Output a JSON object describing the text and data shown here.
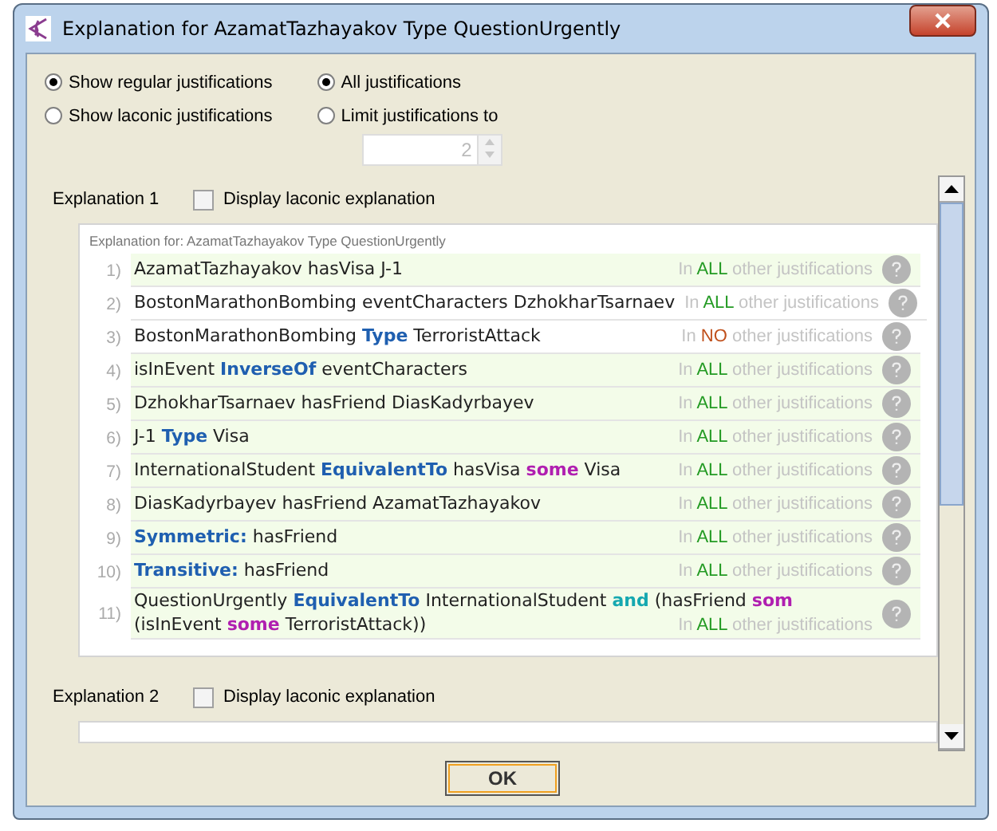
{
  "window": {
    "title": "Explanation for AzamatTazhayakov Type QuestionUrgently"
  },
  "justification_mode": [
    {
      "label": "Show regular justifications",
      "selected": true
    },
    {
      "label": "Show laconic justifications",
      "selected": false
    }
  ],
  "count_mode": [
    {
      "label": "All justifications",
      "selected": true
    },
    {
      "label": "Limit justifications to",
      "selected": false
    }
  ],
  "limit_spinner": {
    "value": "2",
    "disabled": true
  },
  "explanations": [
    {
      "title": "Explanation 1",
      "laconic_checkbox": {
        "label": "Display laconic explanation",
        "checked": false
      },
      "header": "Explanation for: AzamatTazhayakov Type QuestionUrgently",
      "axioms": [
        {
          "number": "1)",
          "highlighted": true,
          "lines": [
            [
              {
                "kind": "plain",
                "text": "AzamatTazhayakov hasVisa J-1"
              }
            ]
          ],
          "justification": {
            "prefix": "In",
            "scope": "ALL",
            "color": "#239a23",
            "suffix": "other justifications"
          }
        },
        {
          "number": "2)",
          "highlighted": false,
          "lines": [
            [
              {
                "kind": "plain",
                "text": "BostonMarathonBombing eventCharacters DzhokharTsarnaev"
              }
            ]
          ],
          "justification": {
            "prefix": "In",
            "scope": "ALL",
            "color": "#239a23",
            "suffix": "other justifications"
          }
        },
        {
          "number": "3)",
          "highlighted": false,
          "lines": [
            [
              {
                "kind": "plain",
                "text": "BostonMarathonBombing "
              },
              {
                "kind": "keyword",
                "text": "Type"
              },
              {
                "kind": "plain",
                "text": " TerroristAttack"
              }
            ]
          ],
          "justification": {
            "prefix": "In",
            "scope": "NO",
            "color": "#c0501c",
            "suffix": "other justifications"
          }
        },
        {
          "number": "4)",
          "highlighted": true,
          "lines": [
            [
              {
                "kind": "plain",
                "text": "isInEvent "
              },
              {
                "kind": "keyword",
                "text": "InverseOf"
              },
              {
                "kind": "plain",
                "text": " eventCharacters"
              }
            ]
          ],
          "justification": {
            "prefix": "In",
            "scope": "ALL",
            "color": "#239a23",
            "suffix": "other justifications"
          }
        },
        {
          "number": "5)",
          "highlighted": true,
          "lines": [
            [
              {
                "kind": "plain",
                "text": "DzhokharTsarnaev hasFriend DiasKadyrbayev"
              }
            ]
          ],
          "justification": {
            "prefix": "In",
            "scope": "ALL",
            "color": "#239a23",
            "suffix": "other justifications"
          }
        },
        {
          "number": "6)",
          "highlighted": true,
          "lines": [
            [
              {
                "kind": "plain",
                "text": "J-1 "
              },
              {
                "kind": "keyword",
                "text": "Type"
              },
              {
                "kind": "plain",
                "text": " Visa"
              }
            ]
          ],
          "justification": {
            "prefix": "In",
            "scope": "ALL",
            "color": "#239a23",
            "suffix": "other justifications"
          }
        },
        {
          "number": "7)",
          "highlighted": true,
          "lines": [
            [
              {
                "kind": "plain",
                "text": "InternationalStudent "
              },
              {
                "kind": "keyword",
                "text": "EquivalentTo"
              },
              {
                "kind": "plain",
                "text": " hasVisa "
              },
              {
                "kind": "quantifier",
                "text": "some"
              },
              {
                "kind": "plain",
                "text": " Visa"
              }
            ]
          ],
          "justification": {
            "prefix": "In",
            "scope": "ALL",
            "color": "#239a23",
            "suffix": "other justifications"
          }
        },
        {
          "number": "8)",
          "highlighted": true,
          "lines": [
            [
              {
                "kind": "plain",
                "text": "DiasKadyrbayev hasFriend AzamatTazhayakov"
              }
            ]
          ],
          "justification": {
            "prefix": "In",
            "scope": "ALL",
            "color": "#239a23",
            "suffix": "other justifications"
          }
        },
        {
          "number": "9)",
          "highlighted": true,
          "lines": [
            [
              {
                "kind": "keyword",
                "text": "Symmetric:"
              },
              {
                "kind": "plain",
                "text": " hasFriend"
              }
            ]
          ],
          "justification": {
            "prefix": "In",
            "scope": "ALL",
            "color": "#239a23",
            "suffix": "other justifications"
          }
        },
        {
          "number": "10)",
          "highlighted": true,
          "lines": [
            [
              {
                "kind": "keyword",
                "text": "Transitive:"
              },
              {
                "kind": "plain",
                "text": " hasFriend"
              }
            ]
          ],
          "justification": {
            "prefix": "In",
            "scope": "ALL",
            "color": "#239a23",
            "suffix": "other justifications"
          }
        },
        {
          "number": "11)",
          "highlighted": true,
          "lines": [
            [
              {
                "kind": "plain",
                "text": "QuestionUrgently "
              },
              {
                "kind": "keyword",
                "text": "EquivalentTo"
              },
              {
                "kind": "plain",
                "text": " InternationalStudent "
              },
              {
                "kind": "connective",
                "text": "and"
              },
              {
                "kind": "plain",
                "text": " (hasFriend "
              },
              {
                "kind": "quantifier",
                "text": "som"
              }
            ],
            [
              {
                "kind": "plain",
                "text": "(isInEvent "
              },
              {
                "kind": "quantifier",
                "text": "some"
              },
              {
                "kind": "plain",
                "text": " TerroristAttack))"
              }
            ]
          ],
          "justification": {
            "prefix": "In",
            "scope": "ALL",
            "color": "#239a23",
            "suffix": "other justifications"
          }
        }
      ]
    },
    {
      "title": "Explanation 2",
      "laconic_checkbox": {
        "label": "Display laconic explanation",
        "checked": false
      }
    }
  ],
  "buttons": [
    {
      "label": "OK",
      "focused": true
    }
  ]
}
